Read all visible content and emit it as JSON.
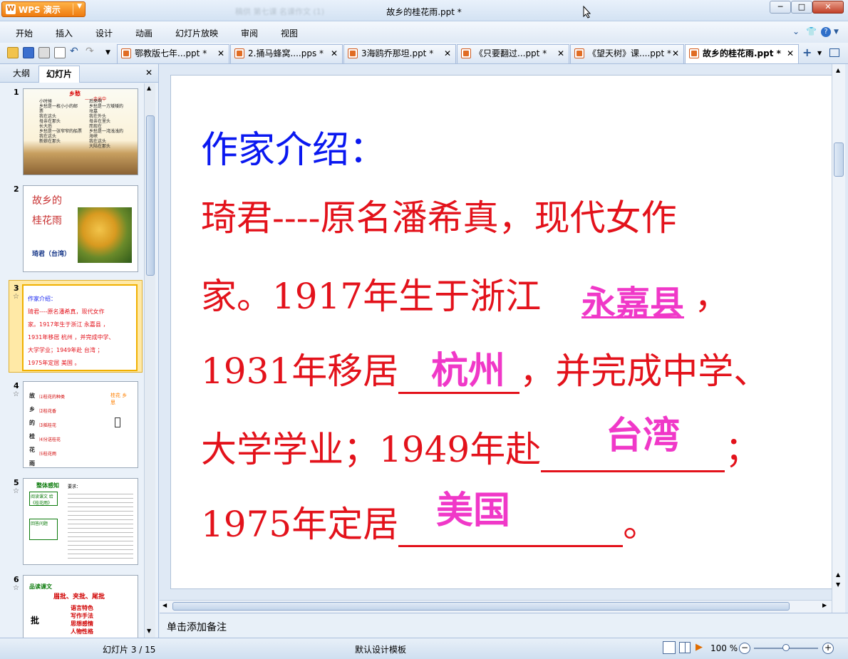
{
  "app": {
    "name": "WPS 演示",
    "window_title": "故乡的桂花雨.ppt *",
    "blurred_text": "稿供 第七课 名课作文 (1)"
  },
  "window_controls": {
    "minimize": "─",
    "maximize": "□",
    "close": "✕"
  },
  "menu": [
    "开始",
    "插入",
    "设计",
    "动画",
    "幻灯片放映",
    "审阅",
    "视图"
  ],
  "tabs": [
    {
      "label": "鄂教版七年...ppt *",
      "close": "✕"
    },
    {
      "label": "2.捅马蜂窝....pps *",
      "close": "✕"
    },
    {
      "label": "3海鸥乔那坦.ppt *",
      "close": "✕"
    },
    {
      "label": "《只要翻过...ppt *",
      "close": "✕"
    },
    {
      "label": "《望天树》课....ppt *",
      "close": "✕"
    },
    {
      "label": "故乡的桂花雨.ppt *",
      "close": "✕",
      "active": true
    }
  ],
  "left_pane": {
    "tab_outline": "大纲",
    "tab_slides": "幻灯片",
    "close": "✕"
  },
  "thumbnails": [
    {
      "num": "1",
      "title": "乡愁",
      "author": "——余光中",
      "lines": [
        "小时候",
        "乡愁是一枚小小的邮",
        "票",
        "我在这头",
        "母亲在那头",
        "长大后",
        "乡愁是一张窄窄的船票",
        "我在这头",
        "新娘在那头"
      ],
      "right_lines": [
        "后来啊",
        "乡愁是一方矮矮的",
        "坟墓",
        "我在外头",
        "母亲在里头",
        "而现在",
        "乡愁是一湾浅浅的",
        "海峡",
        "我在这头",
        "大陆在那头"
      ]
    },
    {
      "num": "2",
      "title1": "故乡的",
      "title2": "桂花雨",
      "author": "琦君（台湾）"
    },
    {
      "num": "3",
      "star": "☆",
      "lines": [
        "作家介绍：",
        "琦君----原名潘希真，现代女作",
        "家。1917年生于浙江  永嘉县  ，",
        "1931年移居  杭州  ，并完成中学、",
        "大学学业；1949年赴   台湾   ；",
        "1975年定居  美国  。"
      ]
    },
    {
      "num": "4",
      "star": "☆",
      "vert": [
        "故",
        "乡",
        "的",
        "桂",
        "花",
        "雨"
      ],
      "items": [
        "⑴桂花的种类",
        "⑵桂花香",
        "⑶摇桂花",
        "⑷分送桂花",
        "⑸桂花雨"
      ],
      "side": "桂花 乡 思"
    },
    {
      "num": "5",
      "star": "☆",
      "label": "整体感知",
      "box1": "阅读课文 给《桂花雨》",
      "box2": "回答问题",
      "right_head": "要求："
    },
    {
      "num": "6",
      "star": "☆",
      "label": "品读课文",
      "head": "眉批、夹批、尾批",
      "vert": "批",
      "items": [
        "语言特色",
        "写作手法",
        "思想感情",
        "人物性格"
      ]
    }
  ],
  "slide": {
    "title": "作家介绍：",
    "line1": "琦君----原名潘希真，现代女作",
    "line2_pre": "家。1917年生于浙江",
    "line2_post": "，",
    "line3_pre": "1931年移居",
    "line3_post": "，并完成中学、",
    "line4_pre": "大学学业；1949年赴",
    "line4_post": "；",
    "line5_pre": "1975年定居",
    "line5_post": "。",
    "answer1": "永嘉县",
    "answer2": "杭州",
    "answer3": "台湾",
    "answer4": "美国"
  },
  "notes_placeholder": "单击添加备注",
  "status": {
    "slide_counter": "幻灯片 3 / 15",
    "template": "默认设计模板",
    "zoom": "100 %"
  },
  "colors": {
    "title_blue": "#0a18f0",
    "body_red": "#e3121b",
    "answer_magenta": "#f038c8",
    "accent_orange": "#ee7b10"
  }
}
